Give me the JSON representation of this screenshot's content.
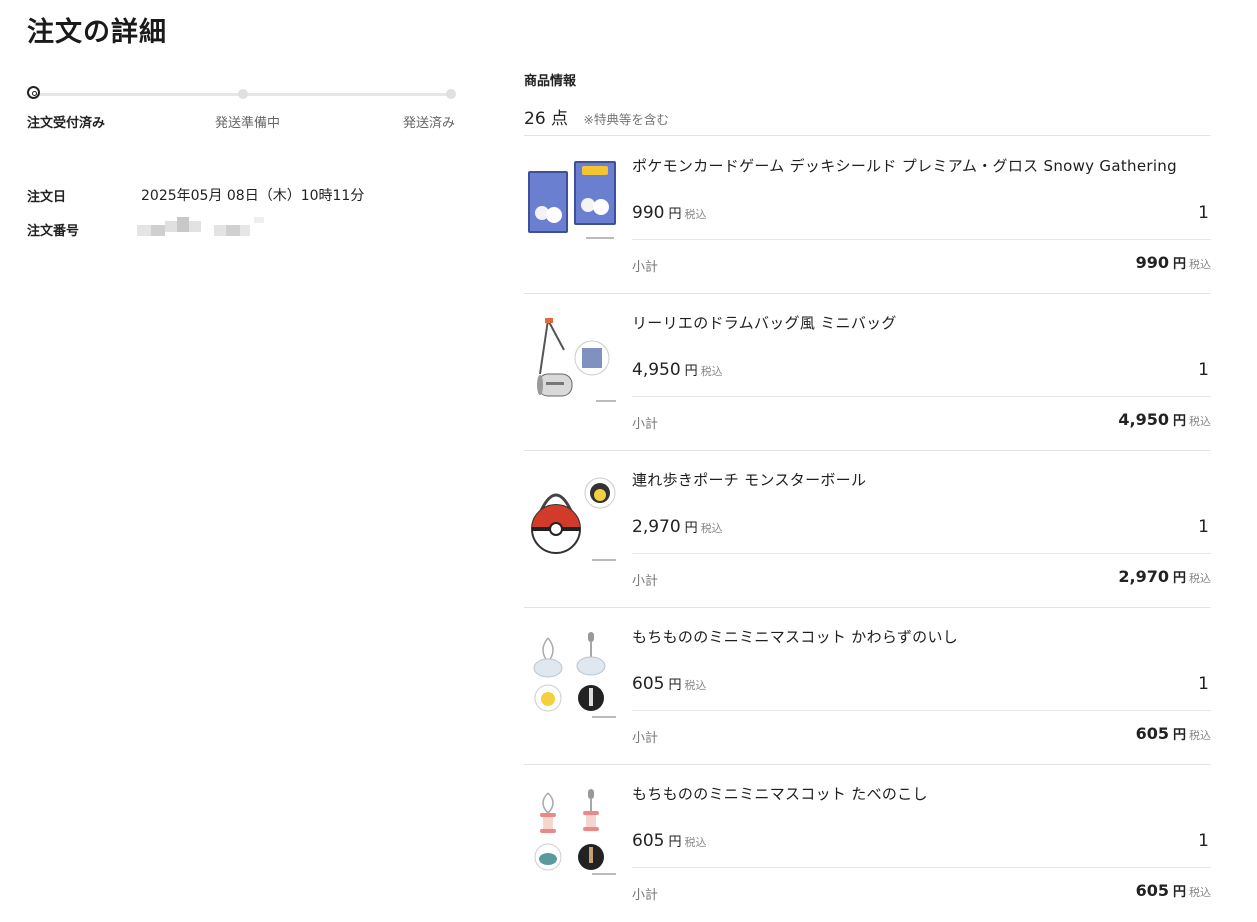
{
  "page": {
    "title": "注文の詳細"
  },
  "progress": {
    "steps": [
      "注文受付済み",
      "発送準備中",
      "発送済み"
    ],
    "current_step": 1
  },
  "order": {
    "date_label": "注文日",
    "date_value": "2025年05月 08日（木）10時11分",
    "number_label": "注文番号"
  },
  "products": {
    "section_label": "商品情報",
    "count": "26",
    "count_unit": "点",
    "count_note": "※特典等を含む",
    "currency": "円",
    "tax_label": "税込",
    "subtotal_label": "小計",
    "items": [
      {
        "name": "ポケモンカードゲーム デッキシールド プレミアム・グロス Snowy Gathering",
        "price": "990",
        "qty": "1",
        "subtotal": "990",
        "thumb": "deck-shield"
      },
      {
        "name": "リーリエのドラムバッグ風 ミニバッグ",
        "price": "4,950",
        "qty": "1",
        "subtotal": "4,950",
        "thumb": "mini-bag"
      },
      {
        "name": "連れ歩きポーチ モンスターボール",
        "price": "2,970",
        "qty": "1",
        "subtotal": "2,970",
        "thumb": "pokeball-pouch"
      },
      {
        "name": "もちもののミニミニマスコット かわらずのいし",
        "price": "605",
        "qty": "1",
        "subtotal": "605",
        "thumb": "everstone-mascot"
      },
      {
        "name": "もちもののミニミニマスコット たべのこし",
        "price": "605",
        "qty": "1",
        "subtotal": "605",
        "thumb": "leftovers-mascot"
      }
    ]
  },
  "colors": {
    "text": "#222222",
    "muted": "#777777",
    "divider": "#e3e3e3",
    "pokeball_red": "#d23a2a"
  }
}
